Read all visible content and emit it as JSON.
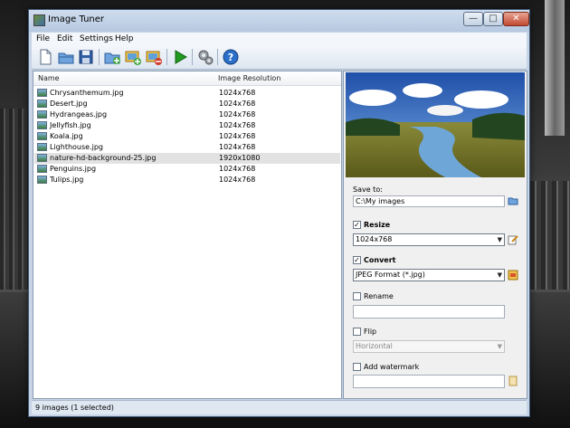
{
  "window": {
    "title": "Image Tuner"
  },
  "window_buttons": {
    "minimize": "—",
    "maximize": "□",
    "close": "✕"
  },
  "menu": [
    "File",
    "Edit",
    "Settings",
    "Help"
  ],
  "toolbar": {
    "icons": [
      "new-icon",
      "open-folder-icon",
      "save-icon",
      "add-folder-icon",
      "add-images-icon",
      "remove-images-icon",
      "run-icon",
      "settings-icon",
      "help-icon"
    ],
    "colors": {
      "run": "#1f9a1f",
      "help": "#2a6fc9"
    }
  },
  "filelist": {
    "columns": [
      "Name",
      "Image Resolution"
    ],
    "rows": [
      {
        "name": "Chrysanthemum.jpg",
        "resolution": "1024x768"
      },
      {
        "name": "Desert.jpg",
        "resolution": "1024x768"
      },
      {
        "name": "Hydrangeas.jpg",
        "resolution": "1024x768"
      },
      {
        "name": "Jellyfish.jpg",
        "resolution": "1024x768"
      },
      {
        "name": "Koala.jpg",
        "resolution": "1024x768"
      },
      {
        "name": "Lighthouse.jpg",
        "resolution": "1024x768"
      },
      {
        "name": "nature-hd-background-25.jpg",
        "resolution": "1920x1080"
      },
      {
        "name": "Penguins.jpg",
        "resolution": "1024x768"
      },
      {
        "name": "Tulips.jpg",
        "resolution": "1024x768"
      }
    ],
    "selected_index": 6
  },
  "panel": {
    "save_to_label": "Save to:",
    "save_to_value": "C:\\My images",
    "resize": {
      "label": "Resize",
      "checked": true,
      "value": "1024x768"
    },
    "convert": {
      "label": "Convert",
      "checked": true,
      "value": "JPEG Format (*.jpg)"
    },
    "rename": {
      "label": "Rename",
      "checked": false,
      "value": ""
    },
    "flip": {
      "label": "Flip",
      "checked": false,
      "value": "Horizontal"
    },
    "watermark": {
      "label": "Add watermark",
      "checked": false,
      "value": ""
    }
  },
  "status": "9 images (1 selected)"
}
